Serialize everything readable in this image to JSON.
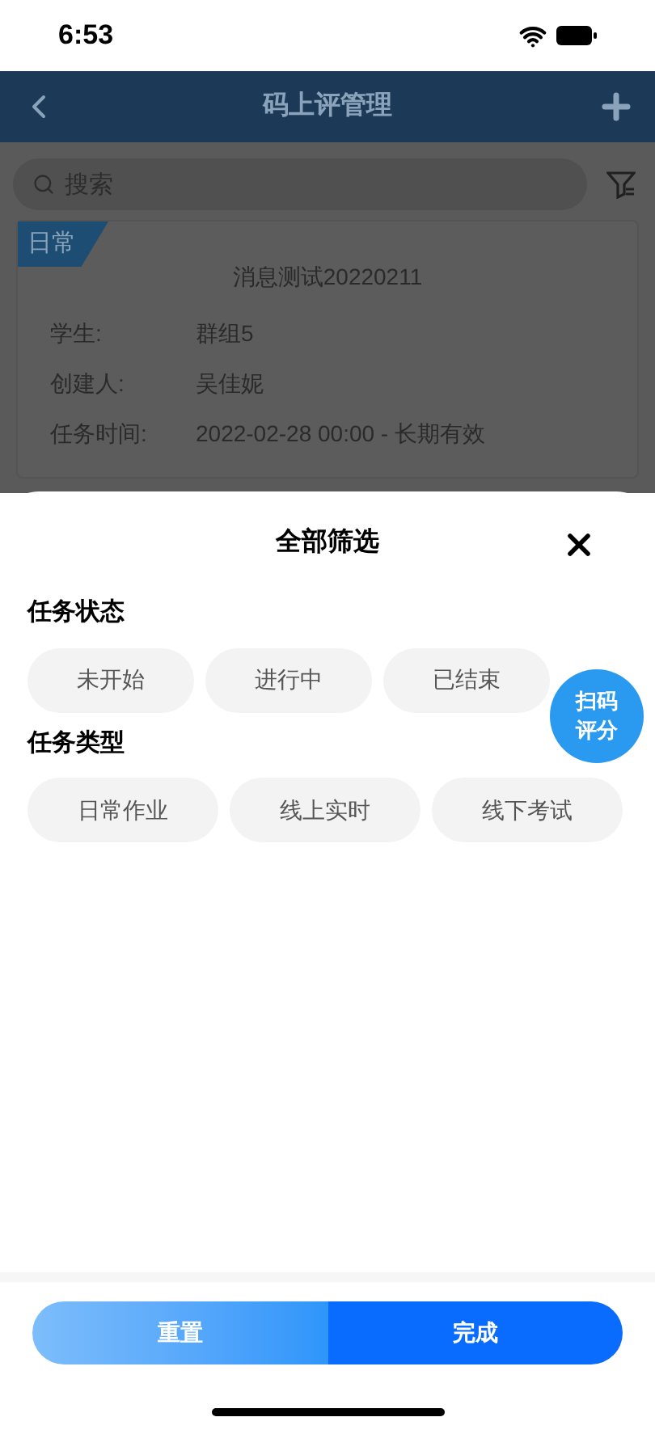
{
  "status_bar": {
    "time": "6:53"
  },
  "nav": {
    "title": "码上评管理"
  },
  "search": {
    "placeholder": "搜索"
  },
  "task_card": {
    "tag": "日常",
    "title": "消息测试20220211",
    "fields": [
      {
        "label": "学生:",
        "value": "群组5"
      },
      {
        "label": "创建人:",
        "value": "吴佳妮"
      },
      {
        "label": "任务时间:",
        "value": "2022-02-28 00:00 - 长期有效"
      }
    ]
  },
  "filter_sheet": {
    "title": "全部筛选",
    "sections": [
      {
        "title": "任务状态",
        "options": [
          {
            "label": "未开始",
            "selected": false
          },
          {
            "label": "进行中",
            "selected": false
          },
          {
            "label": "已结束",
            "selected": false
          }
        ]
      },
      {
        "title": "任务类型",
        "options": [
          {
            "label": "日常作业",
            "selected": false
          },
          {
            "label": "线上实时",
            "selected": false
          },
          {
            "label": "线下考试",
            "selected": false
          }
        ]
      }
    ],
    "buttons": [
      {
        "label": "重置",
        "kind": "reset"
      },
      {
        "label": "完成",
        "kind": "confirm"
      }
    ]
  },
  "floating_button": {
    "lines": [
      "扫码",
      "评分"
    ]
  }
}
